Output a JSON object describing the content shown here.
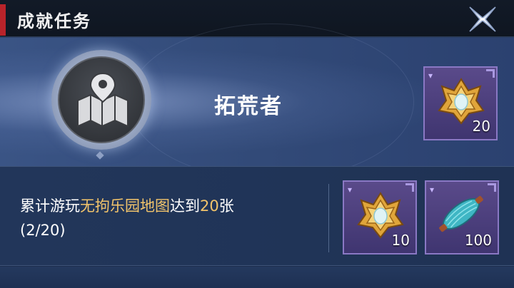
{
  "header": {
    "title": "成就任务",
    "close_icon": "close-x-icon"
  },
  "achievement": {
    "badge_icon": "map-pin-icon",
    "title": "拓荒者",
    "reward": {
      "icon": "golden-emblem-icon",
      "quantity": "20"
    }
  },
  "task": {
    "desc_prefix": "累计游玩",
    "desc_highlight": "无拘乐园地图",
    "desc_middle": "达到",
    "desc_count": "20",
    "desc_suffix": "张",
    "progress": "(2/20)",
    "rewards": [
      {
        "icon": "golden-emblem-icon",
        "quantity": "10"
      },
      {
        "icon": "teal-cocoon-item-icon",
        "quantity": "100"
      }
    ]
  },
  "colors": {
    "accent_red": "#b8232a",
    "highlight_gold": "#f2c46b",
    "reward_purple": "#5a4a8a"
  }
}
